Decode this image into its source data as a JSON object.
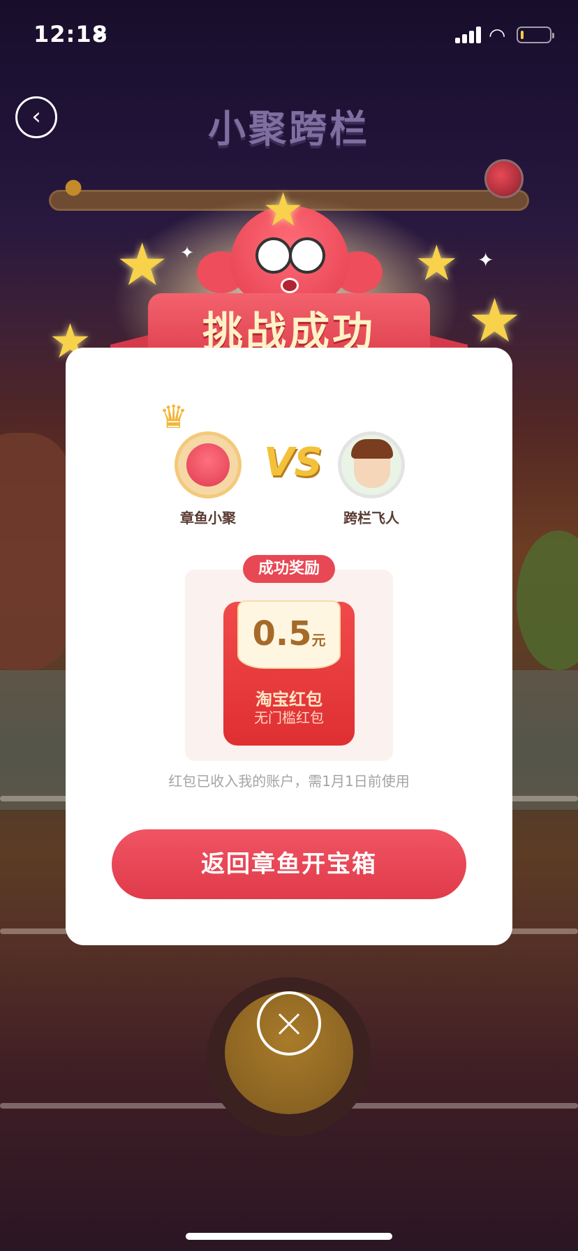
{
  "status_bar": {
    "time": "12:18",
    "location_icon": "location-arrow-icon",
    "signal_icon": "cellular-signal-icon",
    "wifi_icon": "wifi-icon",
    "battery_icon": "battery-low-icon",
    "battery_level_fraction": 0.1
  },
  "header": {
    "back_icon": "chevron-left-icon",
    "title": "小聚跨栏"
  },
  "dialog": {
    "banner_title": "挑战成功",
    "players": [
      {
        "name": "章鱼小聚",
        "avatar": "octopus-avatar",
        "winner": true
      },
      {
        "name": "跨栏飞人",
        "avatar": "runner-avatar",
        "winner": false
      }
    ],
    "vs_label": "VS",
    "reward": {
      "badge": "成功奖励",
      "amount": "0.5",
      "unit": "元",
      "title": "淘宝红包",
      "subtitle": "无门槛红包"
    },
    "note": "红包已收入我的账户，需1月1日前使用",
    "cta_label": "返回章鱼开宝箱",
    "close_icon": "close-icon"
  },
  "colors": {
    "primary": "#e84754",
    "reward_text": "#a66a28",
    "envelope": "#df2f32"
  }
}
